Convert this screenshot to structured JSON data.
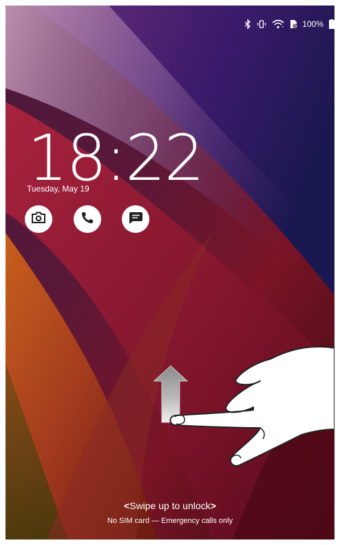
{
  "status_bar": {
    "icons": [
      "bluetooth-icon",
      "vibrate-icon",
      "wifi-icon",
      "sim-missing-icon",
      "battery-icon"
    ],
    "battery_percent": "100%"
  },
  "lockscreen": {
    "time": "18:22",
    "date": "Tuesday, May 19",
    "shortcuts": [
      "camera-icon",
      "phone-icon",
      "message-icon"
    ],
    "unlock_hint": "Swipe up to unlock",
    "unlock_left_chevron": "<",
    "unlock_right_chevron": ">",
    "sim_status": "No SIM card — Emergency calls only"
  },
  "colors": {
    "accent_text": "#ffffff",
    "wallpaper_dark": "#3a0c2c",
    "wallpaper_red": "#a01e3c",
    "wallpaper_orange": "#c2581e"
  },
  "gesture_overlay": {
    "hand_icon": "hand-pointer-icon",
    "arrow_icon": "arrow-up-icon"
  }
}
